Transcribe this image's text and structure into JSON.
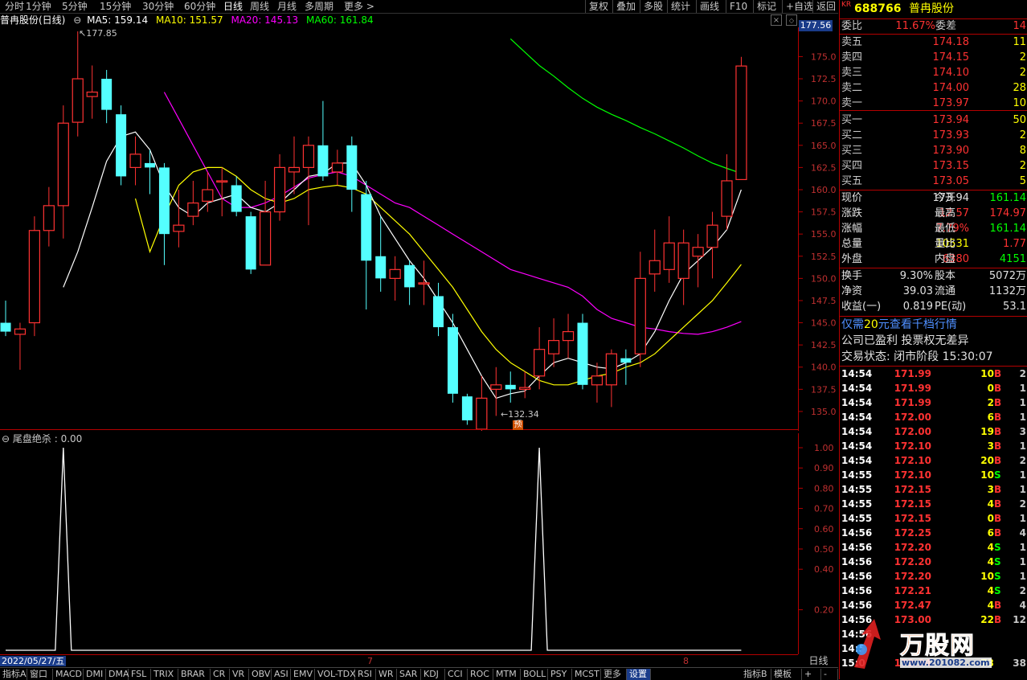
{
  "toolbar": {
    "periods": [
      "分时",
      "1分钟",
      "5分钟",
      "15分钟",
      "30分钟",
      "60分钟",
      "日线",
      "周线",
      "月线",
      "多周期",
      "更多 >"
    ],
    "selected": "日线",
    "right": [
      "复权",
      "叠加",
      "多股",
      "统计",
      "画线",
      "F10",
      "标记",
      "+自选",
      "返回"
    ]
  },
  "ma_line": {
    "name": "普冉股份(日线)",
    "ma5": "MA5: 159.14",
    "ma10": "MA10: 151.57",
    "ma20": "MA20: 145.13",
    "ma60": "MA60: 161.84"
  },
  "colors": {
    "ma5": "#ffffff",
    "ma10": "#ffff00",
    "ma20": "#ff00ff",
    "ma60": "#00ff00",
    "up": "#ff3232",
    "down": "#54ffff",
    "axis": "#b40000"
  },
  "chart_data": [
    {
      "type": "candlestick",
      "title": "普冉股份(日线)",
      "ylim": [
        133.0,
        178.3
      ],
      "y_ticks": [
        135.0,
        137.5,
        140.0,
        142.5,
        145.0,
        147.5,
        150.0,
        152.5,
        155.0,
        157.5,
        160.0,
        162.5,
        165.0,
        167.5,
        170.0,
        172.5,
        175.0
      ],
      "price_tag": "177.56",
      "high_marker": "177.85",
      "low_marker": "132.34",
      "pre_badge": "预",
      "candles": [
        {
          "o": 145.0,
          "c": 144.0,
          "h": 147.5,
          "l": 143.5
        },
        {
          "o": 143.7,
          "c": 144.3,
          "h": 145.0,
          "l": 139.7
        },
        {
          "o": 145.0,
          "c": 155.4,
          "h": 157.0,
          "l": 143.5
        },
        {
          "o": 155.4,
          "c": 158.2,
          "h": 160.3,
          "l": 153.6
        },
        {
          "o": 158.2,
          "c": 167.5,
          "h": 169.5,
          "l": 154.5
        },
        {
          "o": 167.6,
          "c": 172.5,
          "h": 177.85,
          "l": 166.0
        },
        {
          "o": 170.5,
          "c": 171.0,
          "h": 174.0,
          "l": 168.0
        },
        {
          "o": 172.5,
          "c": 169.0,
          "h": 173.5,
          "l": 167.5
        },
        {
          "o": 168.5,
          "c": 161.5,
          "h": 169.5,
          "l": 160.5
        },
        {
          "o": 162.5,
          "c": 164.0,
          "h": 166.0,
          "l": 160.5
        },
        {
          "o": 163.0,
          "c": 162.5,
          "h": 164.5,
          "l": 159.5
        },
        {
          "o": 162.5,
          "c": 155.0,
          "h": 163.0,
          "l": 151.5
        },
        {
          "o": 155.3,
          "c": 156.0,
          "h": 160.0,
          "l": 153.5
        },
        {
          "o": 157.0,
          "c": 158.5,
          "h": 161.0,
          "l": 156.0
        },
        {
          "o": 158.7,
          "c": 160.0,
          "h": 162.0,
          "l": 157.5
        },
        {
          "o": 161.0,
          "c": 161.0,
          "h": 162.5,
          "l": 157.0
        },
        {
          "o": 160.5,
          "c": 157.5,
          "h": 161.5,
          "l": 157.0
        },
        {
          "o": 157.0,
          "c": 151.0,
          "h": 157.5,
          "l": 150.5
        },
        {
          "o": 151.5,
          "c": 157.5,
          "h": 161.0,
          "l": 151.5
        },
        {
          "o": 157.5,
          "c": 162.5,
          "h": 164.0,
          "l": 156.5
        },
        {
          "o": 162.0,
          "c": 162.5,
          "h": 166.0,
          "l": 159.5
        },
        {
          "o": 162.5,
          "c": 165.0,
          "h": 166.0,
          "l": 156.0
        },
        {
          "o": 165.0,
          "c": 161.5,
          "h": 170.0,
          "l": 161.0
        },
        {
          "o": 162.0,
          "c": 163.0,
          "h": 164.5,
          "l": 160.5
        },
        {
          "o": 165.0,
          "c": 160.0,
          "h": 166.0,
          "l": 157.5
        },
        {
          "o": 159.5,
          "c": 152.0,
          "h": 161.0,
          "l": 146.5
        },
        {
          "o": 152.5,
          "c": 150.0,
          "h": 157.0,
          "l": 148.5
        },
        {
          "o": 150.0,
          "c": 151.0,
          "h": 152.5,
          "l": 147.5
        },
        {
          "o": 151.5,
          "c": 149.0,
          "h": 152.0,
          "l": 147.0
        },
        {
          "o": 149.5,
          "c": 149.5,
          "h": 152.0,
          "l": 147.0
        },
        {
          "o": 148.0,
          "c": 144.5,
          "h": 149.5,
          "l": 143.5
        },
        {
          "o": 144.5,
          "c": 137.0,
          "h": 146.0,
          "l": 136.0
        },
        {
          "o": 136.7,
          "c": 134.0,
          "h": 137.0,
          "l": 133.5
        },
        {
          "o": 133.0,
          "c": 136.5,
          "h": 139.0,
          "l": 132.34
        },
        {
          "o": 137.5,
          "c": 138.0,
          "h": 140.0,
          "l": 134.5
        },
        {
          "o": 138.0,
          "c": 137.5,
          "h": 139.5,
          "l": 136.0
        },
        {
          "o": 137.5,
          "c": 137.7,
          "h": 139.5,
          "l": 136.5
        },
        {
          "o": 139.0,
          "c": 142.0,
          "h": 144.5,
          "l": 137.5
        },
        {
          "o": 141.5,
          "c": 143.0,
          "h": 145.5,
          "l": 140.0
        },
        {
          "o": 143.0,
          "c": 144.0,
          "h": 146.0,
          "l": 141.0
        },
        {
          "o": 145.0,
          "c": 138.0,
          "h": 146.0,
          "l": 137.5
        },
        {
          "o": 138.0,
          "c": 139.0,
          "h": 140.5,
          "l": 136.0
        },
        {
          "o": 138.0,
          "c": 141.5,
          "h": 142.0,
          "l": 135.5
        },
        {
          "o": 141.0,
          "c": 140.5,
          "h": 142.0,
          "l": 138.0
        },
        {
          "o": 141.5,
          "c": 150.0,
          "h": 153.0,
          "l": 140.0
        },
        {
          "o": 150.5,
          "c": 152.0,
          "h": 155.5,
          "l": 148.5
        },
        {
          "o": 151.0,
          "c": 154.0,
          "h": 157.0,
          "l": 149.5
        },
        {
          "o": 150.0,
          "c": 154.0,
          "h": 155.5,
          "l": 147.0
        },
        {
          "o": 152.5,
          "c": 153.5,
          "h": 155.0,
          "l": 149.0
        },
        {
          "o": 153.5,
          "c": 156.0,
          "h": 157.5,
          "l": 150.0
        },
        {
          "o": 157.0,
          "c": 161.0,
          "h": 164.0,
          "l": 155.5
        },
        {
          "o": 161.14,
          "c": 173.94,
          "h": 174.97,
          "l": 161.14
        }
      ],
      "ma5": [
        null,
        null,
        null,
        null,
        149.0,
        153.0,
        158.0,
        163.2,
        166.0,
        166.5,
        164.5,
        160.5,
        158.0,
        157.0,
        158.5,
        159.0,
        159.5,
        158.0,
        157.5,
        158.5,
        160.0,
        161.5,
        161.8,
        163.0,
        163.0,
        160.5,
        157.0,
        154.5,
        152.0,
        150.0,
        147.5,
        145.0,
        142.0,
        139.0,
        136.5,
        137.0,
        137.3,
        139.0,
        140.5,
        141.0,
        140.5,
        140.0,
        139.8,
        140.5,
        141.5,
        144.0,
        147.5,
        150.5,
        152.0,
        153.5,
        155.5,
        160.0
      ],
      "ma10": [
        null,
        null,
        null,
        null,
        null,
        null,
        null,
        null,
        null,
        159.0,
        153.0,
        157.0,
        160.5,
        162.0,
        162.5,
        162.5,
        161.5,
        160.0,
        159.0,
        158.5,
        159.0,
        160.0,
        160.3,
        160.5,
        160.2,
        159.5,
        158.0,
        156.5,
        155.0,
        153.0,
        151.0,
        149.0,
        146.5,
        144.0,
        142.0,
        140.5,
        139.5,
        138.5,
        138.0,
        138.0,
        138.5,
        139.0,
        139.3,
        140.0,
        140.5,
        141.5,
        143.0,
        144.5,
        146.0,
        147.5,
        149.5,
        151.57
      ],
      "ma20": [
        null,
        null,
        null,
        null,
        null,
        null,
        null,
        null,
        null,
        null,
        null,
        171.0,
        168.0,
        165.0,
        162.0,
        159.0,
        158.0,
        158.0,
        158.5,
        159.3,
        160.3,
        161.3,
        161.7,
        162.0,
        161.5,
        160.5,
        159.5,
        158.5,
        158.0,
        157.0,
        156.0,
        155.0,
        154.0,
        153.0,
        152.0,
        151.0,
        150.5,
        150.0,
        149.5,
        149.0,
        148.0,
        146.5,
        145.5,
        145.0,
        144.5,
        144.3,
        144.0,
        143.8,
        143.7,
        144.0,
        144.5,
        145.13
      ],
      "ma60": [
        null,
        null,
        null,
        null,
        null,
        null,
        null,
        null,
        null,
        null,
        null,
        null,
        null,
        null,
        null,
        null,
        null,
        null,
        null,
        null,
        null,
        null,
        null,
        null,
        null,
        null,
        null,
        null,
        null,
        null,
        null,
        null,
        null,
        null,
        null,
        177.0,
        175.5,
        174.0,
        172.8,
        171.5,
        170.3,
        169.3,
        168.5,
        167.8,
        167.0,
        166.3,
        165.5,
        164.7,
        163.8,
        163.0,
        162.4,
        161.84
      ]
    },
    {
      "type": "line",
      "title": "尾盘绝杀",
      "value_label": "尾盘绝杀 : 0.00",
      "ylim": [
        0.0,
        1.0
      ],
      "y_ticks": [
        0.2,
        0.4,
        0.5,
        0.6,
        0.7,
        0.8,
        0.9,
        1.0
      ],
      "x": [
        0,
        1,
        2,
        3,
        4,
        5,
        6,
        7,
        8,
        9,
        10,
        11,
        12,
        13,
        14,
        15,
        16,
        17,
        18,
        19,
        20,
        21,
        22,
        23,
        24,
        25,
        26,
        27,
        28,
        29,
        30,
        31,
        32,
        33,
        34,
        35,
        36,
        37,
        38,
        39,
        40,
        41,
        42,
        43,
        44,
        45,
        46,
        47,
        48,
        49,
        50,
        51
      ],
      "values": [
        0,
        0,
        0,
        0,
        1,
        0,
        0,
        0,
        0,
        0,
        0,
        0,
        0,
        0,
        0,
        0,
        0,
        0,
        0,
        0,
        0,
        0,
        0,
        0,
        0,
        0,
        0,
        0,
        0,
        0,
        0,
        0,
        0,
        0,
        0,
        0,
        0,
        1,
        0,
        0,
        0,
        0,
        0,
        0,
        0,
        0,
        0,
        0,
        0,
        0,
        0,
        0
      ]
    }
  ],
  "date_axis": {
    "start": "2022/05/27/五",
    "m7": "7",
    "m8": "8",
    "period": "日线"
  },
  "bottom_tabs": [
    "指标A",
    "窗口",
    "MACD",
    "DMI",
    "DMA",
    "FSL",
    "TRIX",
    "BRAR",
    "CR",
    "VR",
    "OBV",
    "ASI",
    "EMV",
    "VOL-TDX",
    "RSI",
    "WR",
    "SAR",
    "KDJ",
    "CCI",
    "ROC",
    "MTM",
    "BOLL",
    "PSY",
    "MCST",
    "更多",
    "设置"
  ],
  "bottom_right": [
    "指标B",
    "模板",
    "+",
    "-"
  ],
  "quote": {
    "prefix": "KR",
    "code": "688766",
    "name": "普冉股份",
    "webi_label": "委比",
    "webi": "11.67%",
    "weicha_label": "委差",
    "weicha": "14",
    "asks": [
      {
        "label": "卖五",
        "price": "174.18",
        "vol": "11"
      },
      {
        "label": "卖四",
        "price": "174.15",
        "vol": "2"
      },
      {
        "label": "卖三",
        "price": "174.10",
        "vol": "2"
      },
      {
        "label": "卖二",
        "price": "174.00",
        "vol": "28"
      },
      {
        "label": "卖一",
        "price": "173.97",
        "vol": "10"
      }
    ],
    "bids": [
      {
        "label": "买一",
        "price": "173.94",
        "vol": "50"
      },
      {
        "label": "买二",
        "price": "173.93",
        "vol": "2"
      },
      {
        "label": "买三",
        "price": "173.90",
        "vol": "8"
      },
      {
        "label": "买四",
        "price": "173.15",
        "vol": "2"
      },
      {
        "label": "买五",
        "price": "173.05",
        "vol": "5"
      }
    ],
    "stats": [
      {
        "l1": "现价",
        "v1": "173.94",
        "l2": "今开",
        "v2": "161.14"
      },
      {
        "l1": "涨跌",
        "v1": "12.57",
        "l2": "最高",
        "v2": "174.97"
      },
      {
        "l1": "涨幅",
        "v1": "7.79%",
        "l2": "最低",
        "v2": "161.14"
      },
      {
        "l1": "总量",
        "v1": "10531",
        "l2": "量比",
        "v2": "1.77"
      },
      {
        "l1": "外盘",
        "v1": "6380",
        "l2": "内盘",
        "v2": "4151"
      }
    ],
    "stats2": [
      {
        "l1": "换手",
        "v1": "9.30%",
        "l2": "股本",
        "v2": "5072万"
      },
      {
        "l1": "净资",
        "v1": "39.03",
        "l2": "流通",
        "v2": "1132万"
      },
      {
        "l1": "收益(一)",
        "v1": "0.819",
        "l2": "PE(动)",
        "v2": "53.1"
      }
    ],
    "promo_pre": "仅需",
    "promo_num": "20",
    "promo_post": "元查看千档行情",
    "notice": "公司已盈利 投票权无差异",
    "status_label": "交易状态:",
    "status": "闭市阶段",
    "status_time": "15:30:07"
  },
  "ticks": [
    {
      "t": "14:54",
      "p": "171.99",
      "v": "10",
      "d": "B",
      "n": "2"
    },
    {
      "t": "14:54",
      "p": "171.99",
      "v": "0",
      "d": "B",
      "n": "1"
    },
    {
      "t": "14:54",
      "p": "171.99",
      "v": "2",
      "d": "B",
      "n": "1"
    },
    {
      "t": "14:54",
      "p": "172.00",
      "v": "6",
      "d": "B",
      "n": "1"
    },
    {
      "t": "14:54",
      "p": "172.00",
      "v": "19",
      "d": "B",
      "n": "3"
    },
    {
      "t": "14:54",
      "p": "172.10",
      "v": "3",
      "d": "B",
      "n": "1"
    },
    {
      "t": "14:54",
      "p": "172.10",
      "v": "20",
      "d": "B",
      "n": "2"
    },
    {
      "t": "14:55",
      "p": "172.10",
      "v": "10",
      "d": "S",
      "n": "1"
    },
    {
      "t": "14:55",
      "p": "172.15",
      "v": "3",
      "d": "B",
      "n": "1"
    },
    {
      "t": "14:55",
      "p": "172.15",
      "v": "4",
      "d": "B",
      "n": "2"
    },
    {
      "t": "14:55",
      "p": "172.15",
      "v": "0",
      "d": "B",
      "n": "1"
    },
    {
      "t": "14:56",
      "p": "172.25",
      "v": "6",
      "d": "B",
      "n": "4"
    },
    {
      "t": "14:56",
      "p": "172.20",
      "v": "4",
      "d": "S",
      "n": "1"
    },
    {
      "t": "14:56",
      "p": "172.20",
      "v": "4",
      "d": "S",
      "n": "1"
    },
    {
      "t": "14:56",
      "p": "172.20",
      "v": "10",
      "d": "S",
      "n": "1"
    },
    {
      "t": "14:56",
      "p": "172.21",
      "v": "4",
      "d": "S",
      "n": "2"
    },
    {
      "t": "14:56",
      "p": "172.47",
      "v": "4",
      "d": "B",
      "n": "4"
    },
    {
      "t": "14:56",
      "p": "173.00",
      "v": "22",
      "d": "B",
      "n": "12"
    },
    {
      "t": "14:56",
      "p": "",
      "v": "",
      "d": "",
      "n": ""
    },
    {
      "t": "14:5",
      "p": "",
      "v": "",
      "d": "",
      "n": ""
    },
    {
      "t": "15:0",
      "p": "173.94",
      "v": "73",
      "d": "",
      "n": "38"
    }
  ],
  "watermark": {
    "logo": "万股网",
    "url": "www.201082.com"
  }
}
